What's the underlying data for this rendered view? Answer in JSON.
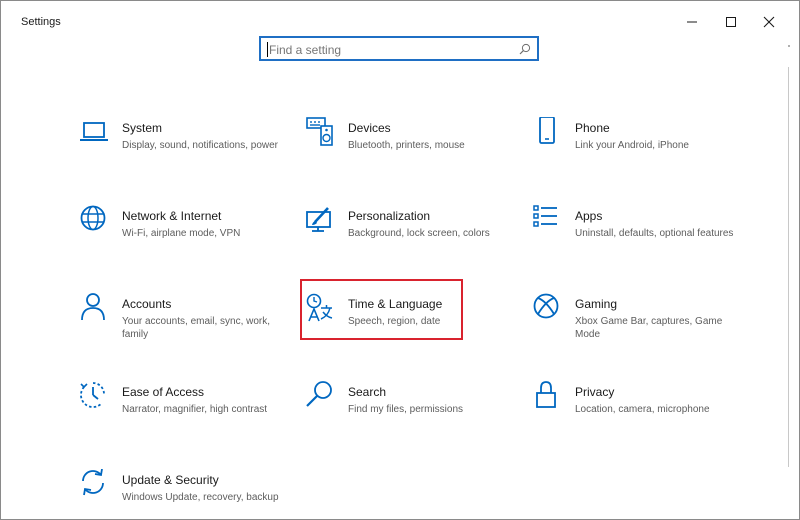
{
  "window": {
    "title": "Settings",
    "minimize_label": "",
    "maximize_label": "",
    "close_label": ""
  },
  "search": {
    "placeholder": "Find a setting",
    "value": ""
  },
  "colors": {
    "accent": "#0067c0",
    "highlight": "#d9232e",
    "search_border": "#1f6fc4"
  },
  "tiles": [
    {
      "title": "System",
      "desc": "Display, sound, notifications, power",
      "icon": "laptop-icon"
    },
    {
      "title": "Devices",
      "desc": "Bluetooth, printers, mouse",
      "icon": "devices-icon"
    },
    {
      "title": "Phone",
      "desc": "Link your Android, iPhone",
      "icon": "phone-icon"
    },
    {
      "title": "Network & Internet",
      "desc": "Wi-Fi, airplane mode, VPN",
      "icon": "globe-icon"
    },
    {
      "title": "Personalization",
      "desc": "Background, lock screen, colors",
      "icon": "paintbrush-icon"
    },
    {
      "title": "Apps",
      "desc": "Uninstall, defaults, optional features",
      "icon": "apps-list-icon"
    },
    {
      "title": "Accounts",
      "desc": "Your accounts, email, sync, work, family",
      "icon": "person-icon"
    },
    {
      "title": "Time & Language",
      "desc": "Speech, region, date",
      "icon": "time-language-icon"
    },
    {
      "title": "Gaming",
      "desc": "Xbox Game Bar, captures, Game Mode",
      "icon": "xbox-icon"
    },
    {
      "title": "Ease of Access",
      "desc": "Narrator, magnifier, high contrast",
      "icon": "ease-of-access-icon"
    },
    {
      "title": "Search",
      "desc": "Find my files, permissions",
      "icon": "magnifier-icon"
    },
    {
      "title": "Privacy",
      "desc": "Location, camera, microphone",
      "icon": "lock-icon"
    },
    {
      "title": "Update & Security",
      "desc": "Windows Update, recovery, backup",
      "icon": "sync-arrows-icon"
    }
  ]
}
